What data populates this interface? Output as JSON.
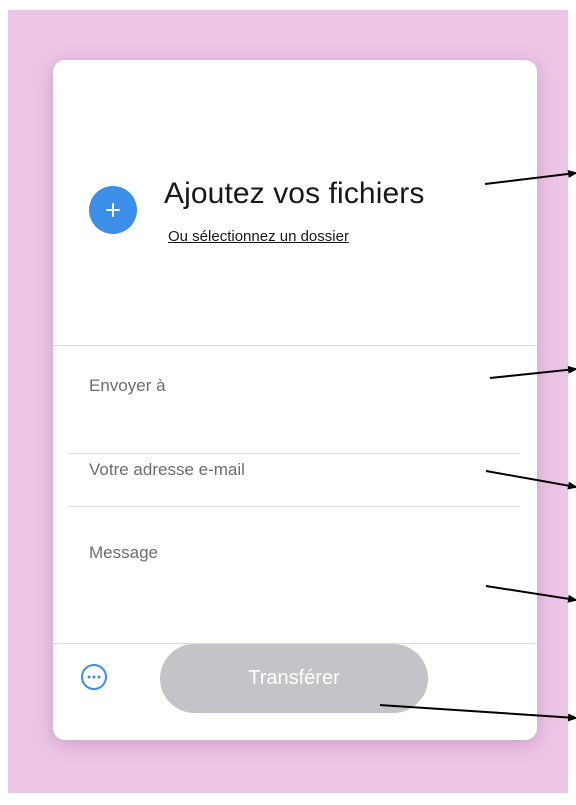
{
  "upload": {
    "title": "Ajoutez vos fichiers",
    "folder_link": "Ou sélectionnez un dossier",
    "add_icon": "plus-icon"
  },
  "form": {
    "send_to_placeholder": "Envoyer à",
    "email_placeholder": "Votre adresse e-mail",
    "message_placeholder": "Message"
  },
  "actions": {
    "more_icon": "more-options-icon",
    "transfer_label": "Transférer"
  },
  "colors": {
    "background": "#ecc5e6",
    "accent": "#3b8fe8",
    "button_disabled": "#c2c4c7",
    "card": "#ffffff"
  }
}
